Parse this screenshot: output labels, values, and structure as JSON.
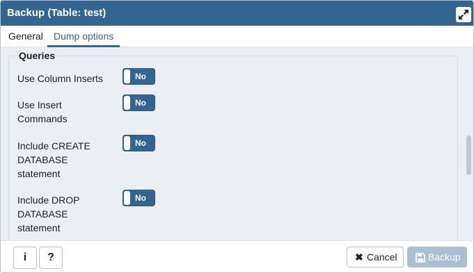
{
  "dialog": {
    "title": "Backup (Table: test)",
    "maximize_icon": "expand-arrows-icon"
  },
  "tabs": [
    {
      "label": "General",
      "active": false
    },
    {
      "label": "Dump options",
      "active": true
    }
  ],
  "section": {
    "legend": "Queries",
    "options": [
      {
        "label": "Use Column Inserts",
        "value": "No"
      },
      {
        "label": "Use Insert Commands",
        "value": "No"
      },
      {
        "label": "Include CREATE DATABASE statement",
        "value": "No"
      },
      {
        "label": "Include DROP DATABASE statement",
        "value": "No"
      }
    ]
  },
  "footer": {
    "info_label": "i",
    "help_label": "?",
    "cancel_label": "Cancel",
    "backup_label": "Backup",
    "backup_enabled": false
  },
  "colors": {
    "accent": "#326690",
    "toggle_off": "#326690",
    "backup_disabled": "#a9bfd2",
    "panel_background": "#ebeef3"
  }
}
